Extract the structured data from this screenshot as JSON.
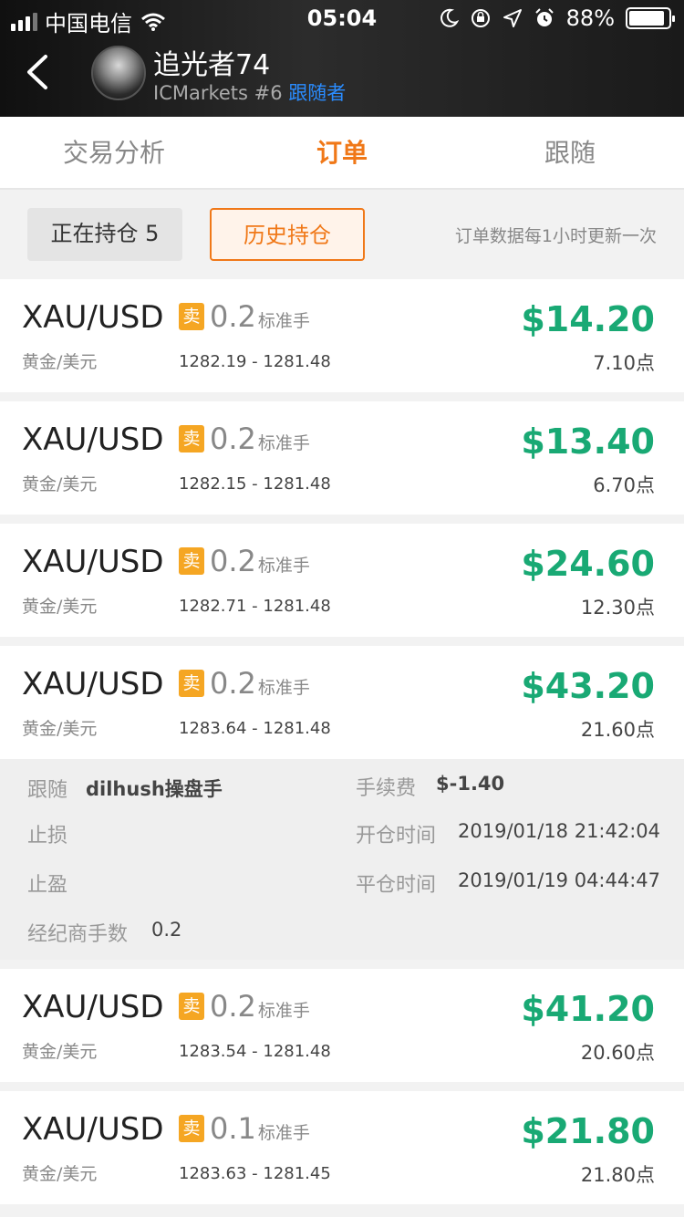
{
  "status_bar": {
    "carrier": "中国电信",
    "time": "05:04",
    "battery": "88%"
  },
  "header": {
    "user_name": "追光者74",
    "broker": "ICMarkets #6",
    "role": "跟随者"
  },
  "tabs": [
    {
      "label": "交易分析",
      "active": false
    },
    {
      "label": "订单",
      "active": true
    },
    {
      "label": "跟随",
      "active": false
    }
  ],
  "filters": {
    "open_label": "正在持仓 5",
    "history_label": "历史持仓",
    "note": "订单数据每1小时更新一次"
  },
  "orders": [
    {
      "symbol": "XAU/USD",
      "symbol_sub": "黄金/美元",
      "side": "卖",
      "lots": "0.2",
      "unit": "标准手",
      "prices": "1282.19 - 1281.48",
      "profit": "$14.20",
      "points": "7.10点"
    },
    {
      "symbol": "XAU/USD",
      "symbol_sub": "黄金/美元",
      "side": "卖",
      "lots": "0.2",
      "unit": "标准手",
      "prices": "1282.15 - 1281.48",
      "profit": "$13.40",
      "points": "6.70点"
    },
    {
      "symbol": "XAU/USD",
      "symbol_sub": "黄金/美元",
      "side": "卖",
      "lots": "0.2",
      "unit": "标准手",
      "prices": "1282.71 - 1281.48",
      "profit": "$24.60",
      "points": "12.30点"
    },
    {
      "symbol": "XAU/USD",
      "symbol_sub": "黄金/美元",
      "side": "卖",
      "lots": "0.2",
      "unit": "标准手",
      "prices": "1283.64 - 1281.48",
      "profit": "$43.20",
      "points": "21.60点"
    },
    {
      "symbol": "XAU/USD",
      "symbol_sub": "黄金/美元",
      "side": "卖",
      "lots": "0.2",
      "unit": "标准手",
      "prices": "1283.54 - 1281.48",
      "profit": "$41.20",
      "points": "20.60点"
    },
    {
      "symbol": "XAU/USD",
      "symbol_sub": "黄金/美元",
      "side": "卖",
      "lots": "0.1",
      "unit": "标准手",
      "prices": "1283.63 - 1281.45",
      "profit": "$21.80",
      "points": "21.80点"
    }
  ],
  "detail": {
    "follow_label": "跟随",
    "follow_value": "dilhush操盘手",
    "stop_loss_label": "止损",
    "take_profit_label": "止盈",
    "broker_lots_label": "经纪商手数",
    "broker_lots_value": "0.2",
    "fee_label": "手续费",
    "fee_value": "$-1.40",
    "open_time_label": "开仓时间",
    "open_time_value": "2019/01/18 21:42:04",
    "close_time_label": "平仓时间",
    "close_time_value": "2019/01/19 04:44:47"
  },
  "colors": {
    "accent": "#f07818",
    "profit": "#19a974",
    "sell_badge": "#f5a623",
    "link": "#2a8cff"
  }
}
